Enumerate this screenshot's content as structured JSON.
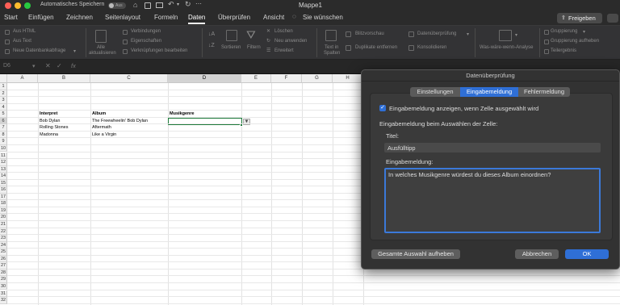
{
  "titlebar": {
    "autosave_label": "Automatisches Speichern",
    "autosave_state": "Aus",
    "document_title": "Mappe1"
  },
  "tabs": [
    "Start",
    "Einfügen",
    "Zeichnen",
    "Seitenlayout",
    "Formeln",
    "Daten",
    "Überprüfen",
    "Ansicht"
  ],
  "active_tab": "Daten",
  "tell_me": "Sie wünschen",
  "share_button": "Freigeben",
  "comment_icon": "speech-bubble-icon",
  "ribbon": {
    "aus_html": "Aus HTML",
    "aus_text": "Aus Text",
    "neue_abfrage": "Neue Datenbankabfrage",
    "alle_aktualisieren_1": "Alle",
    "alle_aktualisieren_2": "aktualisieren",
    "verbindungen": "Verbindungen",
    "eigenschaften": "Eigenschaften",
    "verknuepfungen": "Verknüpfungen bearbeiten",
    "sortieren": "Sortieren",
    "filtern": "Filtern",
    "loeschen": "Löschen",
    "neu_anwenden": "Neu anwenden",
    "erweitert": "Erweitert",
    "text_in_spalten_1": "Text in",
    "text_in_spalten_2": "Spalten",
    "blitzvorschau": "Blitzvorschau",
    "duplikate": "Duplikate entfernen",
    "datenueberpruefung": "Datenüberprüfung",
    "konsolidieren": "Konsolidieren",
    "was_waere_wenn": "Was-wäre-wenn-Analyse",
    "gruppierung": "Gruppierung",
    "gruppierung_aufheben": "Gruppierung aufheben",
    "teilergebnis": "Teilergebnis"
  },
  "formula_bar": {
    "name_box": "D6",
    "fx": "fx",
    "formula": ""
  },
  "grid": {
    "columns": [
      "A",
      "B",
      "C",
      "D",
      "E",
      "F",
      "G",
      "H"
    ],
    "selected_column": "D",
    "rows": [
      "1",
      "2",
      "3",
      "4",
      "5",
      "6",
      "7",
      "8",
      "9",
      "10",
      "11",
      "12",
      "13",
      "14",
      "15",
      "16",
      "17",
      "18",
      "19",
      "20",
      "21",
      "22",
      "23",
      "24",
      "25",
      "26",
      "27",
      "28",
      "29",
      "30",
      "31",
      "32"
    ],
    "selected_row": "6",
    "cells": {
      "B5": "Interpret",
      "C5": "Album",
      "D5": "Musikgenre",
      "B6": "Bob Dylan",
      "C6": "The Freewheelin' Bob Dylan",
      "B7": "Rolling Stones",
      "C7": "Aftermath",
      "B8": "Madonna",
      "C8": "Like a Virgin"
    }
  },
  "dialog": {
    "title": "Datenüberprüfung",
    "tabs": [
      "Einstellungen",
      "Eingabemeldung",
      "Fehlermeldung"
    ],
    "active_tab": "Eingabemeldung",
    "checkbox_label": "Eingabemeldung anzeigen, wenn Zelle ausgewählt wird",
    "checkbox_checked": true,
    "section_label": "Eingabemeldung beim Auswählen der Zelle:",
    "title_label": "Titel:",
    "title_value": "Ausfülltipp",
    "message_label": "Eingabemeldung:",
    "message_value": "In welches Musikgenre würdest du dieses Album einordnen?",
    "clear_all_button": "Gesamte Auswahl aufheben",
    "cancel_button": "Abbrechen",
    "ok_button": "OK"
  },
  "colors": {
    "accent_blue": "#2f6fd6",
    "selection_green": "#1d7a3a",
    "dark_chrome": "#2b2b2b"
  }
}
